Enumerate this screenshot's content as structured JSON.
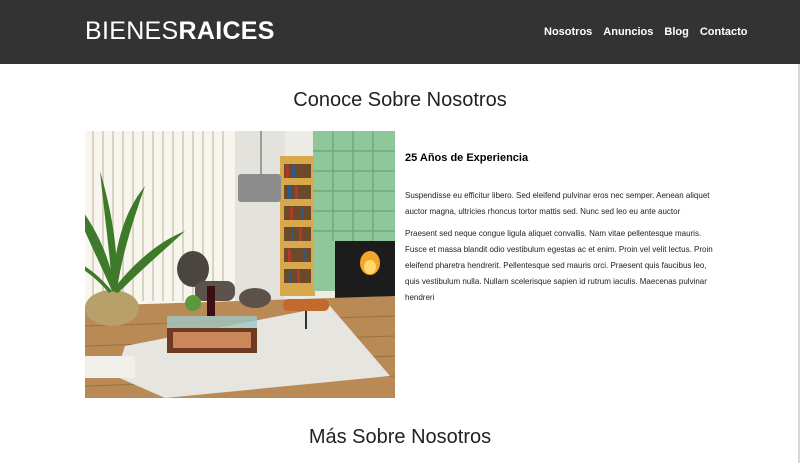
{
  "header": {
    "logo_light": "BIENES",
    "logo_bold": "RAICES",
    "nav": [
      "Nosotros",
      "Anuncios",
      "Blog",
      "Contacto"
    ]
  },
  "main": {
    "title": "Conoce Sobre Nosotros",
    "experience_title": "25 Años de Experiencia",
    "paragraph_1": "Suspendisse eu efficitur libero. Sed eleifend pulvinar eros nec semper. Aenean aliquet auctor magna, ultricies rhoncus tortor mattis sed. Nunc sed leo eu ante auctor",
    "paragraph_2": "Praesent sed neque congue ligula aliquet convallis. Nam vitae pellentesque mauris. Fusce et massa blandit odio vestibulum egestas ac et enim. Proin vel velit lectus. Proin eleifend pharetra hendrerit. Pellentesque sed mauris orci. Praesent quis faucibus leo, quis vestibulum nulla. Nullam scelerisque sapien id rutrum iaculis. Maecenas pulvinar hendreri"
  },
  "section_2": {
    "title": "Más Sobre Nosotros"
  },
  "colors": {
    "header_bg": "#333333",
    "text": "#222222"
  }
}
